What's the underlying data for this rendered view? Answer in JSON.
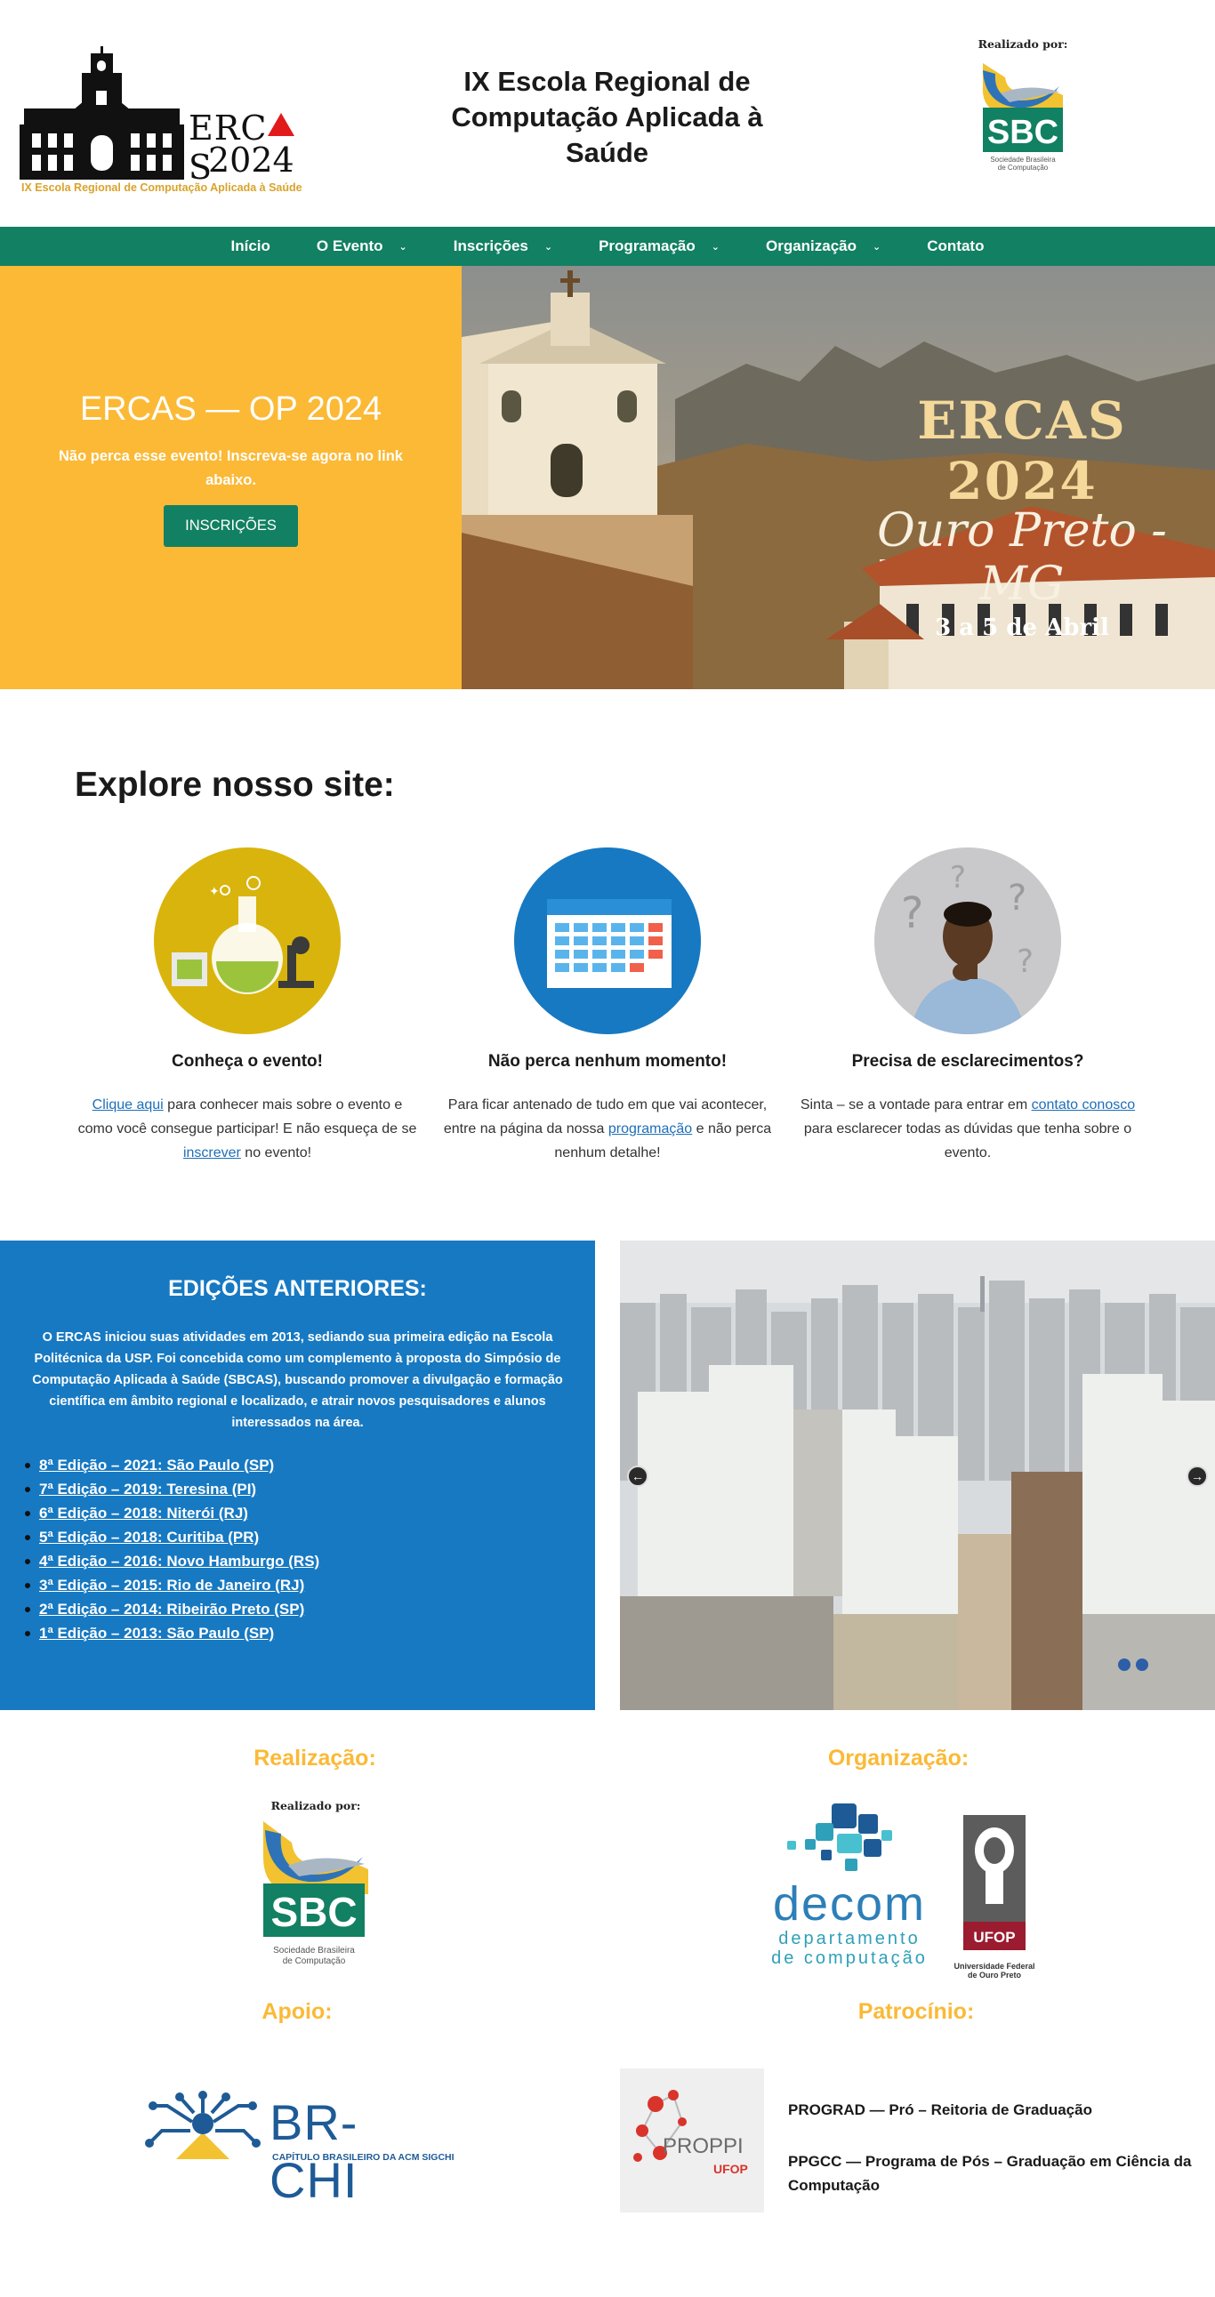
{
  "header": {
    "logo_word": "ERC",
    "logo_word_end": "S",
    "logo_year": "2024",
    "logo_subtitle": "IX Escola Regional de Computação Aplicada à Saúde",
    "title": "IX Escola Regional de Computação Aplicada à Saúde",
    "realizado_label": "Realizado por:",
    "sbc_text": "SBC",
    "sbc_caption_1": "Sociedade Brasileira",
    "sbc_caption_2": "de Computação"
  },
  "nav": {
    "items": [
      {
        "label": "Início",
        "has_dropdown": false
      },
      {
        "label": "O Evento",
        "has_dropdown": true
      },
      {
        "label": "Inscrições",
        "has_dropdown": true
      },
      {
        "label": "Programação",
        "has_dropdown": true
      },
      {
        "label": "Organização",
        "has_dropdown": true
      },
      {
        "label": "Contato",
        "has_dropdown": false
      }
    ]
  },
  "hero": {
    "title": "ERCAS — OP 2024",
    "text": "Não perca esse evento! Inscreva-se agora no link abaixo.",
    "button": "INSCRIÇÕES",
    "banner_title": "ERCAS 2024",
    "banner_script": "Ouro Preto - MG",
    "banner_date": "3 a 5 de Abril"
  },
  "explore": {
    "heading": "Explore nosso site:",
    "cards": [
      {
        "title": "Conheça o evento!",
        "link1": "Clique aqui",
        "text1": " para conhecer mais sobre o evento e como você consegue participar! E não esqueça de se ",
        "link2": "inscrever",
        "text2": " no evento!",
        "icon": "lab-flask-icon"
      },
      {
        "title": "Não perca nenhum momento!",
        "text1": "Para ficar antenado de tudo em que vai acontecer, entre na página da nossa ",
        "link1": "programação",
        "text2": " e não perca nenhum detalhe!",
        "icon": "calendar-icon"
      },
      {
        "title": "Precisa de esclarecimentos?",
        "text1": "Sinta – se a vontade para entrar em ",
        "link1": "contato conosco",
        "text2": " para esclarecer todas as dúvidas que tenha sobre o evento.",
        "icon": "thinking-person-icon"
      }
    ]
  },
  "editions": {
    "heading": "EDIÇÕES ANTERIORES:",
    "intro": "O ERCAS iniciou suas atividades em 2013, sediando sua primeira edição na Escola Politécnica da USP. Foi concebida como um complemento à proposta do Simpósio de Computação Aplicada à Saúde (SBCAS), buscando promover a divulgação e formação científica em âmbito regional e localizado, e atrair novos pesquisadores e alunos interessados na área.",
    "list": [
      "8ª Edição – 2021: São Paulo (SP)",
      "7ª Edição – 2019: Teresina (PI)",
      "6ª Edição – 2018: Niterói (RJ)",
      "5ª Edição – 2018: Curitiba (PR)",
      "4ª Edição – 2016: Novo Hamburgo (RS)",
      "3ª Edição – 2015: Rio de Janeiro (RJ)",
      "2ª Edição – 2014: Ribeirão Preto (SP)",
      "1ª Edição – 2013: São Paulo (SP)"
    ],
    "prev_arrow": "←",
    "next_arrow": "→"
  },
  "sponsors": {
    "realizacao": "Realização:",
    "organizacao": "Organização:",
    "apoio": "Apoio:",
    "patrocinio": "Patrocínio:",
    "decom_word": "decom",
    "decom_sub_1": "departamento",
    "decom_sub_2": "de computação",
    "ufop_label": "UFOP",
    "ufop_caption_1": "Universidade Federal",
    "ufop_caption_2": "de Ouro Preto",
    "brchi_word": "BR-CHI",
    "brchi_sub": "CAPÍTULO BRASILEIRO DA ACM SIGCHI",
    "proppi_word": "PROPPI",
    "proppi_ufop": "UFOP",
    "prograd": "PROGRAD — Pró – Reitoria de Graduação",
    "ppgcc": "PPGCC — Programa de Pós – Graduação em Ciência da Computação"
  },
  "colors": {
    "green": "#128062",
    "yellow": "#fbb936",
    "blue": "#1779c2"
  }
}
